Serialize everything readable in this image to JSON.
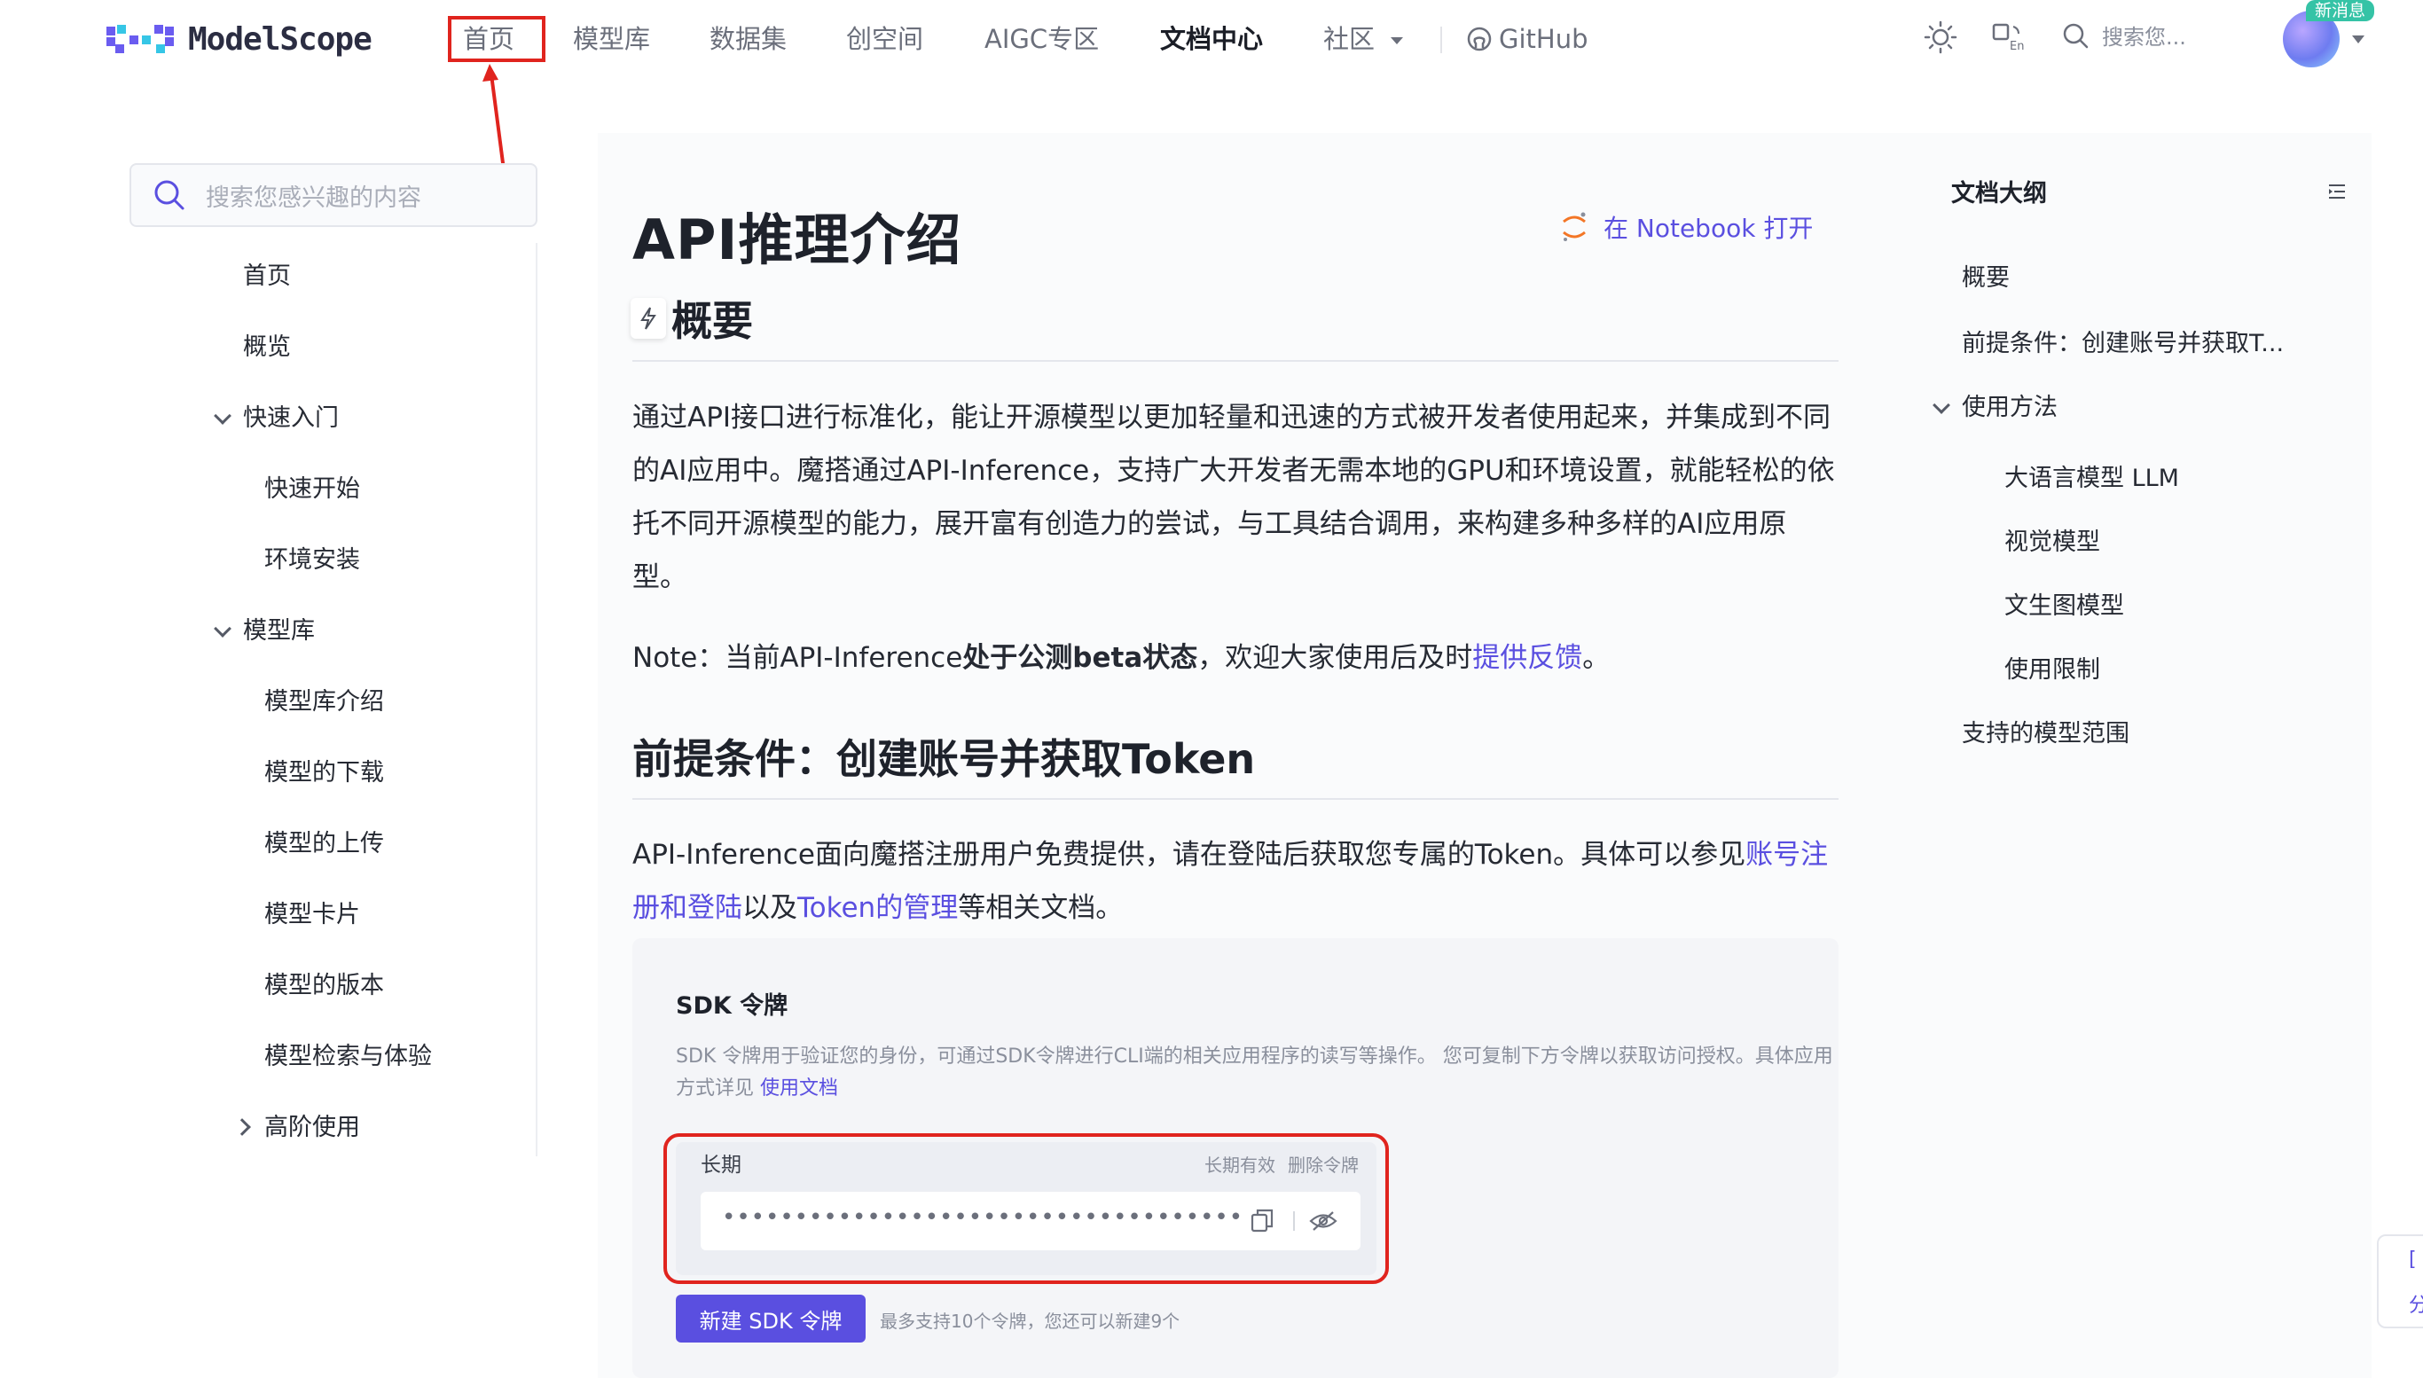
{
  "header": {
    "logo_text": "ModelScope",
    "nav": [
      "首页",
      "模型库",
      "数据集",
      "创空间",
      "AIGC专区",
      "文档中心",
      "社区",
      "GitHub"
    ],
    "search_placeholder": "搜索您...",
    "new_badge": "新消息"
  },
  "sidebar": {
    "search_placeholder": "搜索您感兴趣的内容",
    "items": [
      "首页",
      "概览",
      "快速入门",
      "快速开始",
      "环境安装",
      "模型库",
      "模型库介绍",
      "模型的下载",
      "模型的上传",
      "模型卡片",
      "模型的版本",
      "模型检索与体验",
      "高阶使用"
    ]
  },
  "main": {
    "title": "API推理介绍",
    "notebook_link": "在 Notebook 打开",
    "section1_title": "概要",
    "para1": "通过API接口进行标准化，能让开源模型以更加轻量和迅速的方式被开发者使用起来，并集成到不同的AI应用中。魔搭通过API-Inference，支持广大开发者无需本地的GPU和环境设置，就能轻松的依托不同开源模型的能力，展开富有创造力的尝试，与工具结合调用，来构建多种多样的AI应用原型。",
    "note_prefix": "Note：当前API-Inference",
    "note_bold": "处于公测beta状态",
    "note_mid": "，欢迎大家使用后及时",
    "note_link": "提供反馈",
    "note_end": "。",
    "section2_title": "前提条件：创建账号并获取Token",
    "para2_a": "API-Inference面向魔搭注册用户免费提供，请在登陆后获取您专属的Token。具体可以参见",
    "para2_link1": "账号注册和登陆",
    "para2_b": "以及",
    "para2_link2": "Token的管理",
    "para2_c": "等相关文档。"
  },
  "sdk": {
    "title": "SDK 令牌",
    "desc": "SDK 令牌用于验证您的身份，可通过SDK令牌进行CLI端的相关应用程序的读写等操作。 您可复制下方令牌以获取访问授权。具体应用方式详见 ",
    "desc_link": "使用文档",
    "token_label": "长期",
    "token_validity": "长期有效",
    "token_delete": "删除令牌",
    "token_masked": "••••••••••••••••••••••••••••••••••••",
    "new_button": "新建 SDK 令牌",
    "hint": "最多支持10个令牌，您还可以新建9个"
  },
  "toc": {
    "title": "文档大纲",
    "items": [
      "概要",
      "前提条件：创建账号并获取T...",
      "使用方法",
      "大语言模型 LLM",
      "视觉模型",
      "文生图模型",
      "使用限制",
      "支持的模型范围"
    ]
  },
  "float_widget": {
    "label_top": "[",
    "label_bottom": "分"
  },
  "colors": {
    "accent": "#5a4fe0",
    "annotation": "#e0241e",
    "content_bg": "#fafbfc"
  }
}
